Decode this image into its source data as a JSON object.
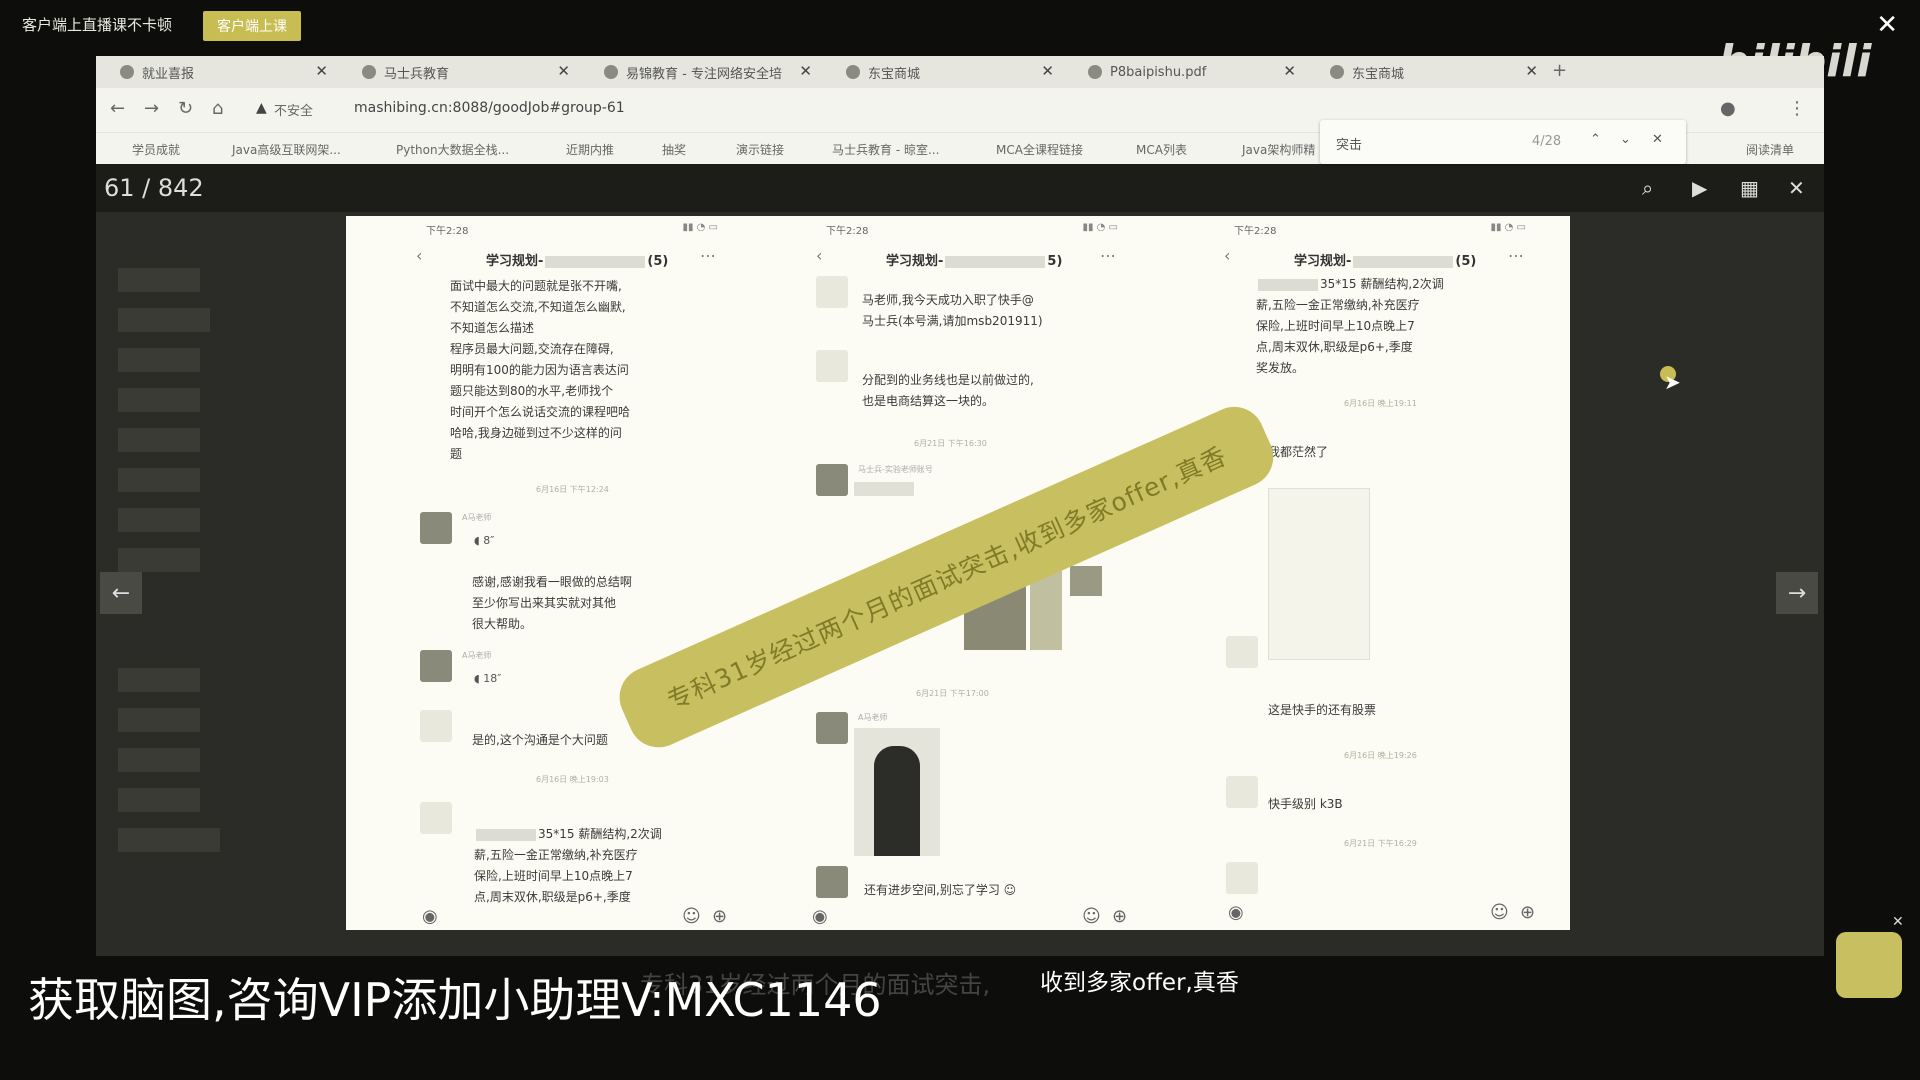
{
  "overlay": {
    "promo_text": "客户端上直播课不卡顿",
    "promo_button": "客户端上课",
    "close": "✕"
  },
  "browser": {
    "tabs": [
      {
        "label": "就业喜报"
      },
      {
        "label": "马士兵教育"
      },
      {
        "label": "易锦教育 - 专注网络安全培"
      },
      {
        "label": "东宝商城"
      },
      {
        "label": "P8baipishu.pdf"
      },
      {
        "label": "东宝商城"
      }
    ],
    "security": "不安全",
    "url": "mashibing.cn:8088/goodJob#group-61",
    "bookmarks": [
      "学员成就",
      "Java高级互联网架...",
      "Python大数据全栈...",
      "近期内推",
      "抽奖",
      "演示链接",
      "马士兵教育 - 晾室...",
      "MCA全课程链接",
      "MCA列表",
      "Java架构师精"
    ],
    "reading_list": "阅读清单",
    "find": {
      "query": "突击",
      "count": "4/28"
    }
  },
  "viewer": {
    "page_counter": "61 / 842"
  },
  "slide": {
    "status_time": "下午2:28",
    "phone1": {
      "title": "学习规划-",
      "count": "(5)",
      "lines": [
        "面试中最大的问题就是张不开嘴,",
        "不知道怎么交流,不知道怎么幽默,",
        "不知道怎么描述",
        "程序员最大问题,交流存在障碍,",
        "明明有100的能力因为语言表达问",
        "题只能达到80的水平,老师找个",
        "时间开个怎么说话交流的课程吧哈",
        "哈哈,我身边碰到过不少这样的问",
        "题"
      ],
      "ts1": "6月16日 下午12:24",
      "teacher": "A马老师",
      "voice1": "8″",
      "reply_lines": [
        "感谢,感谢我看一眼做的总结啊",
        "至少你写出来其实就对其他",
        "很大帮助。"
      ],
      "voice2": "18″",
      "reply2": "是的,这个沟通是个大问题",
      "ts2": "6月16日 晚上19:03",
      "tail_lines": [
        "35*15 薪酬结构,2次调",
        "薪,五险一金正常缴纳,补充医疗",
        "保险,上班时间早上10点晚上7",
        "点,周末双休,职级是p6+,季度"
      ]
    },
    "phone2": {
      "title": "学习规划-",
      "count": "5)",
      "lines1": [
        "马老师,我今天成功入职了快手@",
        "马士兵(本号满,请加msb201911)"
      ],
      "lines2": [
        "分配到的业务线也是以前做过的,",
        "也是电商结算这一块的。"
      ],
      "ts1": "6月21日 下午16:30",
      "sender": "马士兵-实验老师账号",
      "ts2": "6月21日 下午17:00",
      "teacher": "A马老师",
      "reply": "还有进步空间,别忘了学习"
    },
    "phone3": {
      "title": "学习规划-",
      "count": "(5)",
      "lines": [
        "35*15 薪酬结构,2次调",
        "薪,五险一金正常缴纳,补充医疗",
        "保险,上班时间早上10点晚上7",
        "点,周末双休,职级是p6+,季度",
        "奖发放。"
      ],
      "ts1": "6月16日 晚上19:11",
      "m1": "我都茫然了",
      "m2": "这是快手的还有股票",
      "ts2": "6月16日 晚上19:26",
      "m3": "快手级别 k3B",
      "ts3": "6月21日 下午16:29"
    },
    "banner": "专科31岁经过两个月的面试突击,收到多家offer,真香"
  },
  "captions": {
    "watermark": "获取脑图,咨询VIP添加小助理V:MXC1146",
    "subtitle_ghost": "专科31岁经过两个月的面试突击,",
    "subtitle": "收到多家offer,真香",
    "bili_logo": "bilibili"
  }
}
